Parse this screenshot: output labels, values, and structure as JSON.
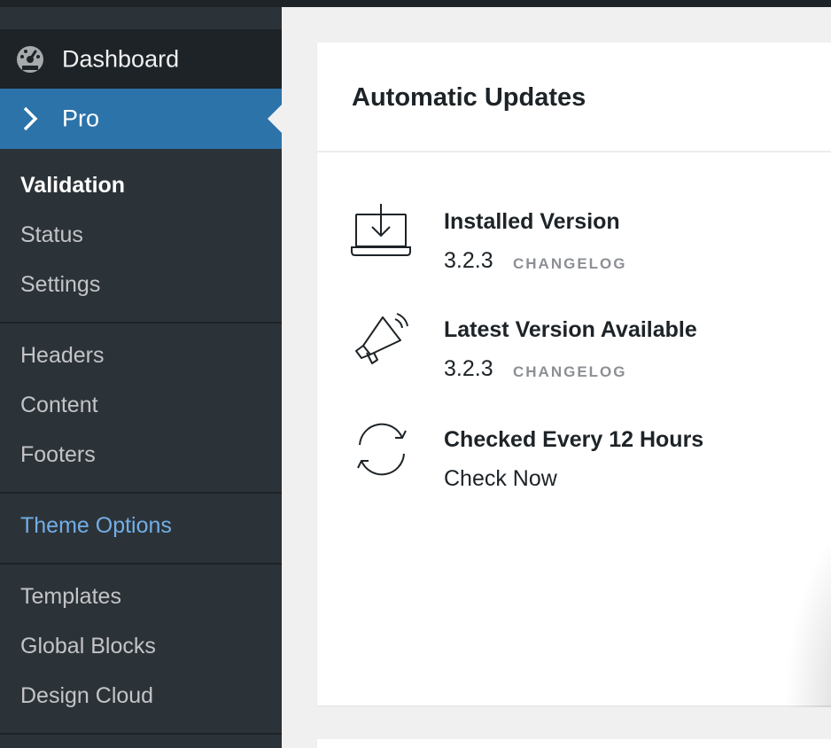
{
  "sidebar": {
    "dashboard_label": "Dashboard",
    "pro_label": "Pro",
    "submenu": [
      {
        "label": "Validation",
        "state": "current"
      },
      {
        "label": "Status"
      },
      {
        "label": "Settings"
      },
      {
        "label": "Headers"
      },
      {
        "label": "Content"
      },
      {
        "label": "Footers"
      },
      {
        "label": "Theme Options",
        "state": "highlighted"
      },
      {
        "label": "Templates"
      },
      {
        "label": "Global Blocks"
      },
      {
        "label": "Design Cloud"
      }
    ]
  },
  "card": {
    "title": "Automatic Updates",
    "rows": [
      {
        "icon": "laptop-download-icon",
        "title": "Installed Version",
        "value": "3.2.3",
        "link": "CHANGELOG"
      },
      {
        "icon": "megaphone-icon",
        "title": "Latest Version Available",
        "value": "3.2.3",
        "link": "CHANGELOG"
      },
      {
        "icon": "refresh-icon",
        "title": "Checked Every 12 Hours",
        "action": "Check Now"
      }
    ]
  },
  "colors": {
    "sidebar_bg": "#2c3338",
    "sidebar_dark": "#1d2327",
    "active_blue": "#2c73aa",
    "accent_link": "#72aee6",
    "muted_text": "#c3c4c7",
    "changelog_gray": "#8c8f94"
  }
}
